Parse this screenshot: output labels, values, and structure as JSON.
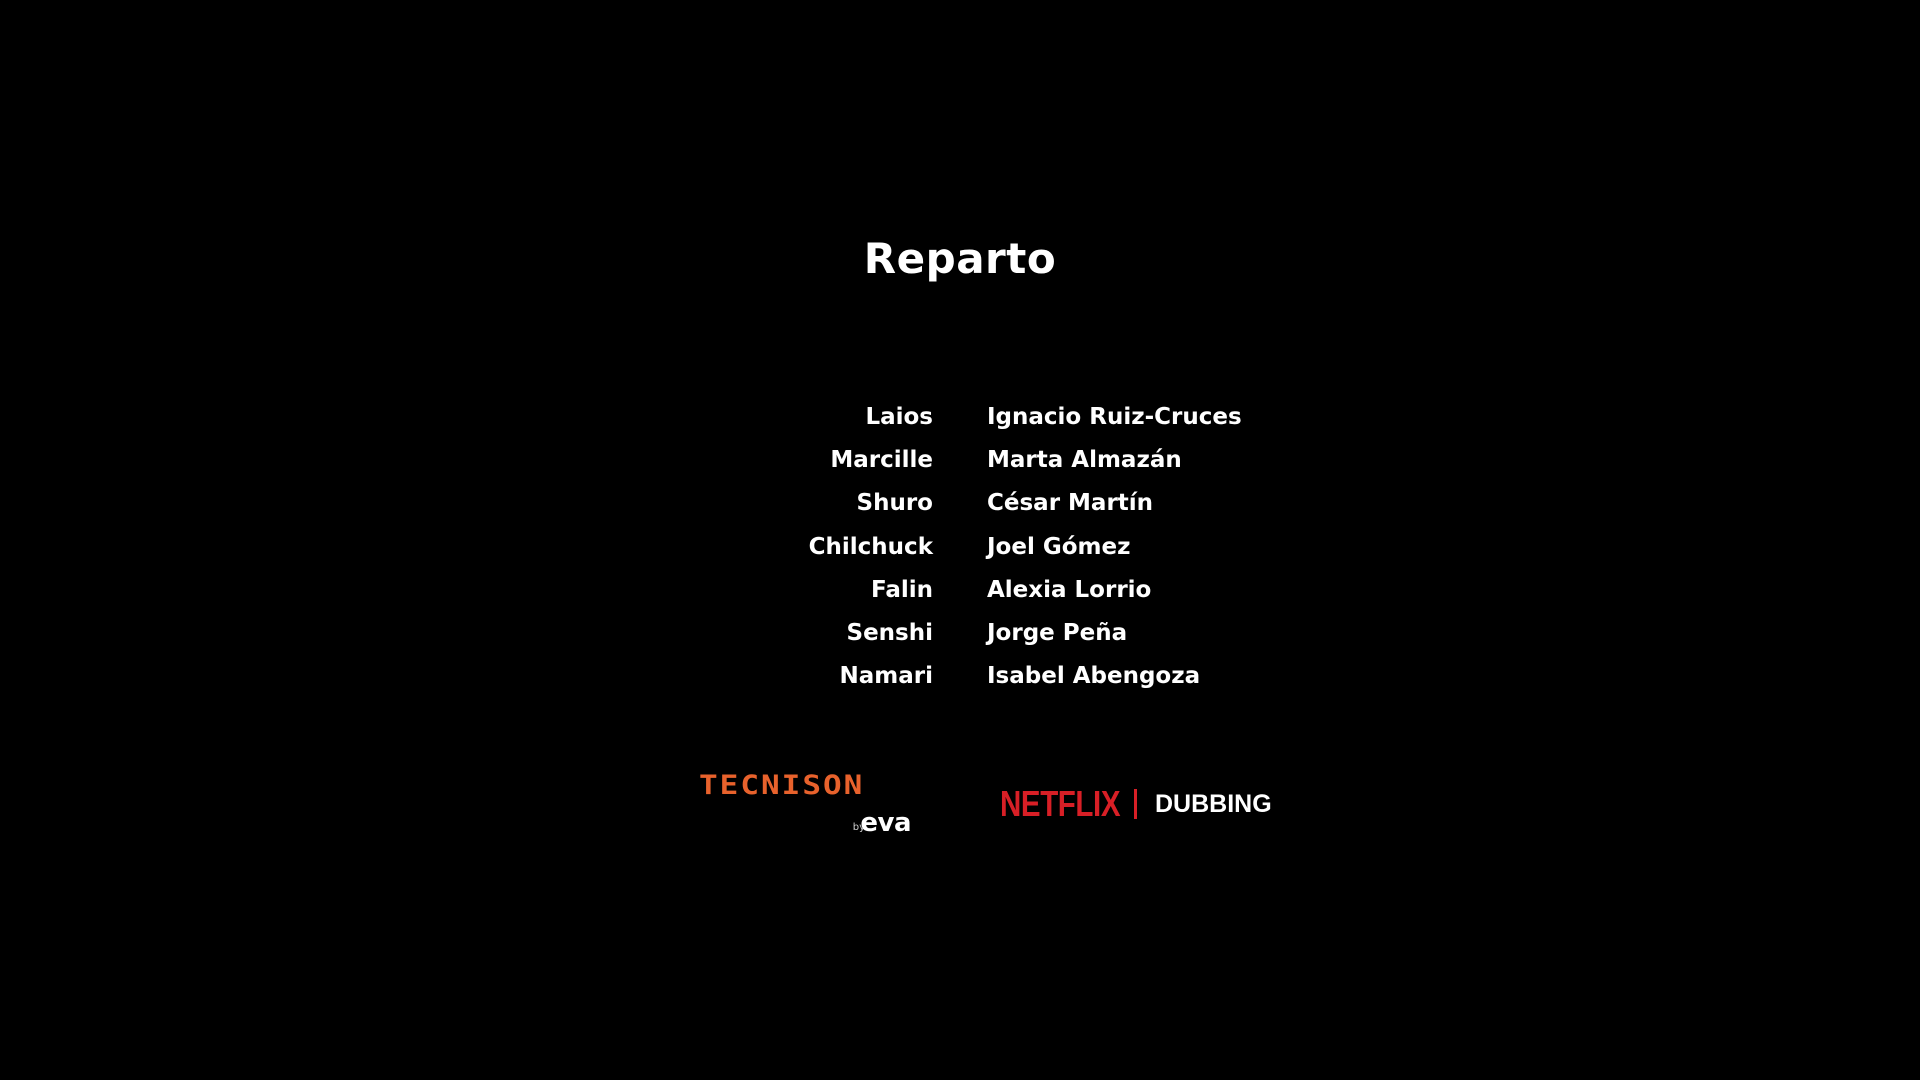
{
  "credits": {
    "title": "Reparto",
    "cast": [
      {
        "role": "Laios",
        "actor": "Ignacio Ruiz-Cruces"
      },
      {
        "role": "Marcille",
        "actor": "Marta Almazán"
      },
      {
        "role": "Shuro",
        "actor": "César Martín"
      },
      {
        "role": "Chilchuck",
        "actor": "Joel Gómez"
      },
      {
        "role": "Falin",
        "actor": "Alexia Lorrio"
      },
      {
        "role": "Senshi",
        "actor": "Jorge Peña"
      },
      {
        "role": "Namari",
        "actor": "Isabel Abengoza"
      }
    ]
  },
  "logos": {
    "tecnison": {
      "name": "TECNISON",
      "by": "by",
      "eva": "eva",
      "color": "#e8622c"
    },
    "netflix": {
      "name": "NETFLIX",
      "label": "DUBBING",
      "color": "#d81f26"
    }
  },
  "colors": {
    "background": "#000000",
    "text": "#ffffff"
  }
}
